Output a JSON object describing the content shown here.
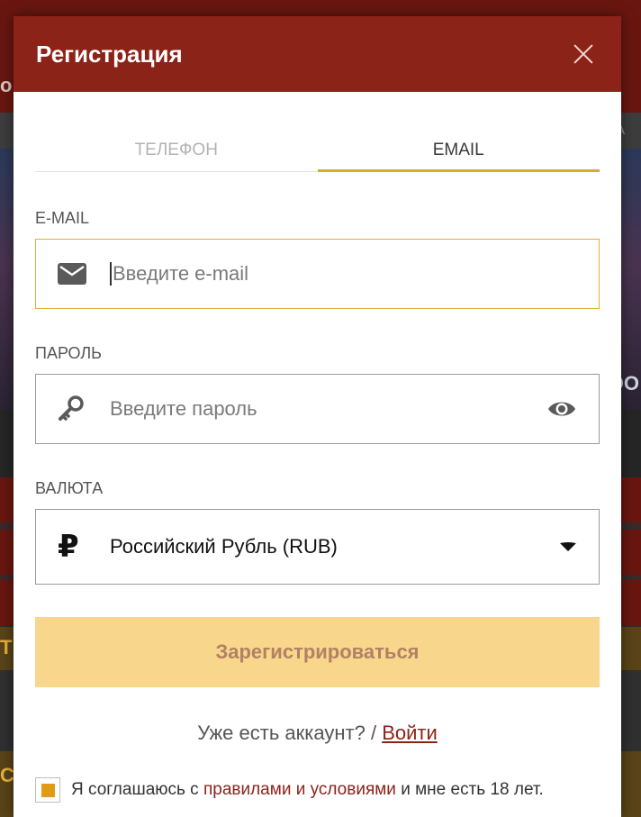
{
  "background": {
    "logo_fragment": "о",
    "nav_fragment": "А",
    "art_fragment": "ОО",
    "gold_fragment": "ТЕ",
    "bottom_fragment": "С"
  },
  "modal": {
    "title": "Регистрация",
    "close_label": "×"
  },
  "tabs": [
    {
      "label": "ТЕЛЕФОН",
      "active": false
    },
    {
      "label": "EMAIL",
      "active": true
    }
  ],
  "email_field": {
    "label": "E-MAIL",
    "placeholder": "Введите e-mail",
    "value": ""
  },
  "password_field": {
    "label": "ПАРОЛЬ",
    "placeholder": "Введите пароль",
    "value": ""
  },
  "currency_field": {
    "label": "ВАЛЮТА",
    "selected": "Российский Рубль (RUB)",
    "symbol": "₽"
  },
  "submit": {
    "label": "Зарегистрироваться"
  },
  "login": {
    "prompt": "Уже есть аккаунт? /",
    "link": "Войти"
  },
  "agreement": {
    "checked": true,
    "prefix": "Я соглашаюсь с",
    "link": "правилами и условиями",
    "suffix": "и мне есть 18 лет."
  },
  "colors": {
    "header": "#8c2319",
    "accent": "#dba832",
    "submit_bg": "#f8d68b",
    "checkbox": "#e29a15",
    "link": "#8c2319"
  }
}
